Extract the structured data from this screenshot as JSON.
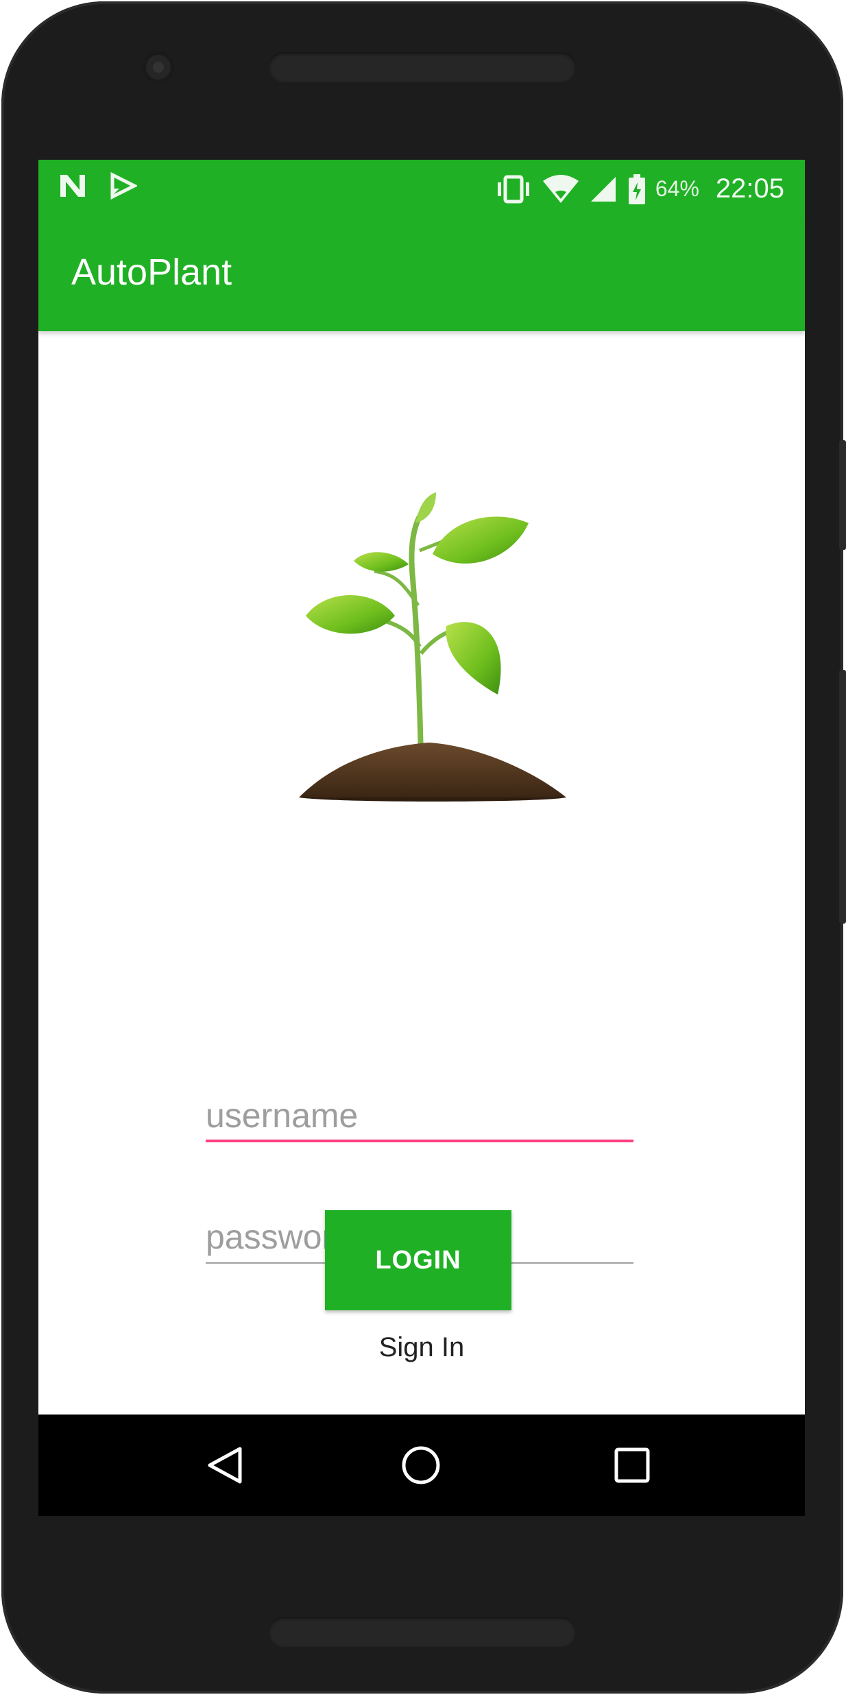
{
  "status_bar": {
    "battery_percent": "64%",
    "time": "22:05",
    "icons": [
      "n-notification-icon",
      "play-notification-icon",
      "vibrate-icon",
      "wifi-icon",
      "cell-signal-icon",
      "battery-icon"
    ]
  },
  "app_bar": {
    "title": "AutoPlant"
  },
  "hero": {
    "image": "plant-sprout-image"
  },
  "form": {
    "username_placeholder": "username",
    "password_placeholder": "password",
    "login_label": "LOGIN",
    "sign_in_label": "Sign In"
  },
  "nav": {
    "icons": [
      "back-icon",
      "home-icon",
      "recents-icon"
    ]
  },
  "colors": {
    "primary": "#20b025",
    "accent": "#ff4081",
    "field_line": "#9e9e9e"
  }
}
